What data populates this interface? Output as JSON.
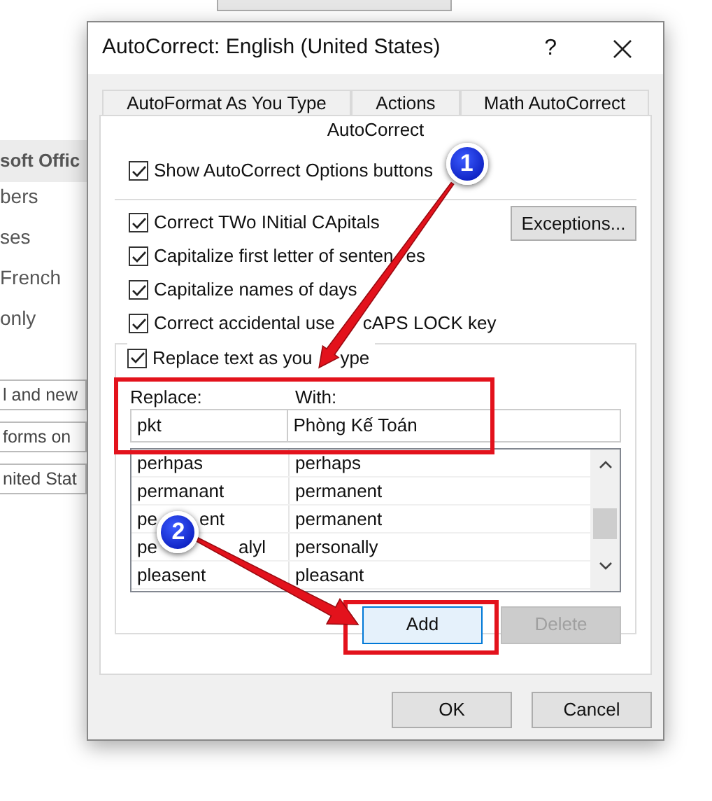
{
  "background_window": {
    "heading": "soft Offic",
    "items": [
      {
        "text": "bers",
        "kind": "text"
      },
      {
        "text": "ses",
        "kind": "text"
      },
      {
        "text": "French",
        "kind": "text"
      },
      {
        "text": "only",
        "kind": "text"
      },
      {
        "text": "l and new",
        "kind": "field"
      },
      {
        "text": "forms on",
        "kind": "field"
      },
      {
        "text": "nited Stat",
        "kind": "field"
      }
    ]
  },
  "dialog": {
    "title": "AutoCorrect: English (United States)",
    "help": "?",
    "tabs": [
      {
        "label": "AutoFormat As You Type",
        "selected": false
      },
      {
        "label": "Actions",
        "selected": false
      },
      {
        "label": "Math AutoCorrect",
        "selected": false
      },
      {
        "label": "AutoCorrect",
        "selected": true
      }
    ],
    "options": [
      {
        "label": "Show AutoCorrect Options buttons",
        "checked": true
      },
      {
        "label": "Correct TWo INitial CApitals",
        "checked": true
      },
      {
        "label": "Capitalize first letter of senten",
        "label_after": "es",
        "checked": true
      },
      {
        "label": "Capitalize names of days",
        "checked": true
      },
      {
        "label": "Correct accidental use",
        "label_after": "cAPS LOCK key",
        "checked": true
      },
      {
        "label": "Replace text as you",
        "label_after": "ype",
        "checked": true
      }
    ],
    "exceptions_button": "Exceptions...",
    "replace": {
      "label": "Replace:",
      "value": "pkt"
    },
    "with": {
      "label": "With:",
      "value": "Phòng Kế Toán"
    },
    "entries": [
      {
        "replace": "perhpas",
        "with": "perhaps"
      },
      {
        "replace": "permanant",
        "with": "permanent"
      },
      {
        "replace": "pe",
        "replace_after": "ent",
        "with": "permanent"
      },
      {
        "replace": "pe",
        "replace_after": "alyl",
        "with": "personally"
      },
      {
        "replace": "pleasent",
        "with": "pleasant"
      }
    ],
    "add_button": {
      "label": "Add",
      "disabled": false
    },
    "delete_button": {
      "label": "Delete",
      "disabled": true
    },
    "footer_buttons": [
      "OK",
      "Cancel"
    ]
  },
  "annotations": [
    {
      "number": "1"
    },
    {
      "number": "2"
    }
  ]
}
